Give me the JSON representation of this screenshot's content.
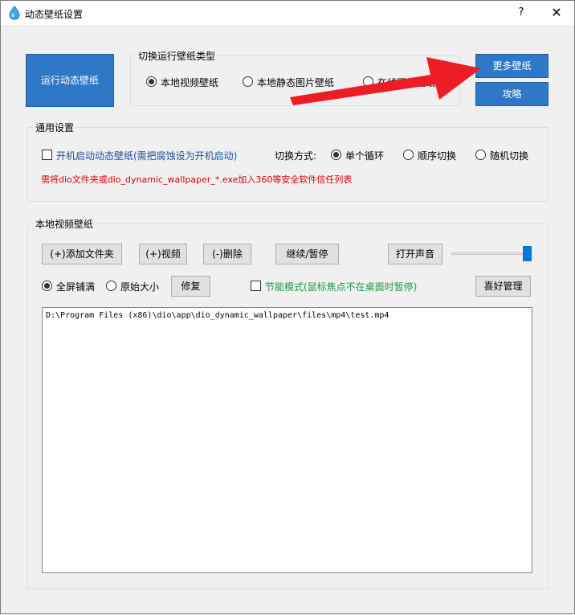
{
  "window": {
    "title": "动态壁纸设置",
    "help_label": "?",
    "close_label": "✕"
  },
  "top": {
    "run_button": "运行动态壁纸",
    "switch_group_title": "切换运行壁纸类型",
    "type_options": [
      {
        "label": "本地视频壁纸",
        "checked": true
      },
      {
        "label": "本地静态图片壁纸",
        "checked": false
      },
      {
        "label": "在线网络壁纸",
        "checked": false
      }
    ],
    "more_button": "更多壁纸",
    "guide_button": "攻略"
  },
  "general": {
    "title": "通用设置",
    "autostart_label": "开机启动动态壁纸(需把腐蚀设为开机启动)",
    "autostart_checked": false,
    "switch_mode_label": "切换方式:",
    "modes": [
      {
        "label": "单个循环",
        "checked": true
      },
      {
        "label": "顺序切换",
        "checked": false
      },
      {
        "label": "随机切换",
        "checked": false
      }
    ],
    "warning": "需将dio文件夹或dio_dynamic_wallpaper_*.exe加入360等安全软件信任列表"
  },
  "local_video": {
    "title": "本地视频壁纸",
    "buttons": {
      "add_folder": "(+)添加文件夹",
      "add_video": "(+)视频",
      "delete": "(-)删除",
      "continue_pause": "继续/暂停",
      "open_sound": "打开声音",
      "repair": "修复",
      "favorites": "喜好管理"
    },
    "volume_percent": 100,
    "fill_modes": [
      {
        "label": "全屏铺满",
        "checked": true
      },
      {
        "label": "原始大小",
        "checked": false
      }
    ],
    "power_save_label": "节能模式(鼠标焦点不在桌面时暂停)",
    "power_save_checked": false,
    "files": [
      "D:\\Program Files (x86)\\dio\\app\\dio_dynamic_wallpaper\\files\\mp4\\test.mp4"
    ]
  },
  "colors": {
    "accent": "#2e78c7",
    "warning": "#d40000",
    "green": "#1a9a4a",
    "arrow": "#ee1c25"
  }
}
